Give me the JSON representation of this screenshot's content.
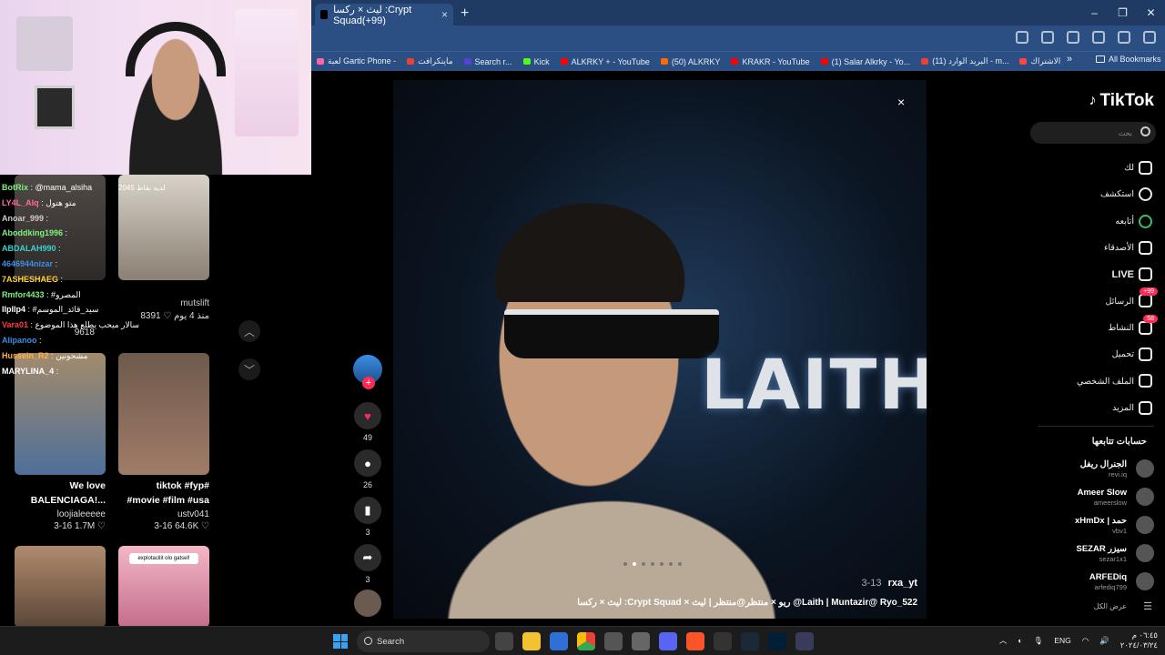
{
  "browser": {
    "tab_title": "ليث × ركسا :Crypt Squad(+99)",
    "tab_close": "×",
    "new_tab": "+",
    "window_buttons": [
      "–",
      "❐",
      "✕"
    ],
    "bookmarks": [
      {
        "label": "الاشتراك",
        "color": "#ff4444"
      },
      {
        "label": "البريد الوارد (11) - m...",
        "color": "#ea4335"
      },
      {
        "label": "(1) Salar Alkrky - Yo...",
        "color": "#ff0000"
      },
      {
        "label": "KRAKR - YouTube",
        "color": "#ff0000"
      },
      {
        "label": "(50) ALKRKY",
        "color": "#ff6a00"
      },
      {
        "label": "ALKRKY + - YouTube",
        "color": "#ff0000"
      },
      {
        "label": "Kick",
        "color": "#53fc18"
      },
      {
        "label": "Search r...",
        "color": "#5b3fd6"
      },
      {
        "label": "ماينكرافت",
        "color": "#ea4335"
      },
      {
        "label": "لعبة Gartic Phone -",
        "color": "#ff66aa"
      }
    ],
    "bookmarks_more": "»",
    "all_bookmarks": "All Bookmarks"
  },
  "chat": [
    {
      "user": "BotRix",
      "text": ": @mama_alsiha",
      "color": "#7cf27c"
    },
    {
      "user": "LY4L_Alq",
      "text": ": متو هتول",
      "color": "#ff6b9d"
    },
    {
      "user": "Anoar_999",
      "text": ":",
      "color": "#ccc"
    },
    {
      "user": "Aboddking1996",
      "text": ":",
      "color": "#7cf27c"
    },
    {
      "user": "ABDALAH990",
      "text": ":",
      "color": "#3ad1d1"
    },
    {
      "user": "4646944nizar",
      "text": ":",
      "color": "#3a8fe6"
    },
    {
      "user": "7ASHESHAEG",
      "text": ":",
      "color": "#ffd23a"
    },
    {
      "user": "Rmfor4433",
      "text": ": #المصرو",
      "color": "#7cf27c"
    },
    {
      "user": "llpllp4",
      "text": ": #سيد_قائد_الموسم",
      "color": "#fff"
    },
    {
      "user": "Vara01",
      "text": ": سالار ميحب يطلع هذا الموضوع",
      "color": "#ff3d3d"
    },
    {
      "user": "Alipanoo",
      "text": ":",
      "color": "#3a8fe6"
    },
    {
      "user": "Hussein_R2",
      "text": ": مشحونين",
      "color": "#ffb347"
    },
    {
      "user": "MARYLINA_4",
      "text": ":",
      "color": "#fff"
    }
  ],
  "left_feed": {
    "t2_overlay": "لديه نقاط 2045",
    "item1": {
      "user": "mutslift",
      "likes": "8391 ♡",
      "date": "منذ 4 يوم",
      "views": "9618"
    },
    "item2": {
      "caption_1": "We love",
      "caption_2": "BALENCIAGA!...",
      "user": "loojialeeeee",
      "date": "3-16",
      "likes": "1.7M ♡"
    },
    "item3": {
      "caption_1": "tiktok #fyp#",
      "caption_2": "#movie #film #usa",
      "user": "ustv041",
      "date": "3-16",
      "likes": "64.6K ♡"
    },
    "item6_banner": "explotacilit olo gatsel!"
  },
  "post": {
    "overlay_title": "LAITH",
    "author": "rxa_yt",
    "date": "3-13",
    "description": "ليث × ركسا :Crypt Squad × ريو × منتظر@منتظر | ليث @Laith | Muntazir@ Ryo_522",
    "likes": "49",
    "comments": "26",
    "saves": "3",
    "shares": "3",
    "close": "×",
    "follow_plus": "+"
  },
  "sidebar": {
    "logo": "TikTok",
    "search_placeholder": "بحث",
    "nav": [
      {
        "label": "لك",
        "icon": "home-icon",
        "bold": false
      },
      {
        "label": "استكشف",
        "icon": "compass-icon",
        "bold": false
      },
      {
        "label": "أتابعه",
        "icon": "following-icon",
        "bold": false
      },
      {
        "label": "الأصدقاء",
        "icon": "friends-icon",
        "bold": false
      },
      {
        "label": "LIVE",
        "icon": "live-icon",
        "bold": true
      },
      {
        "label": "الرسائل",
        "icon": "messages-icon",
        "bold": false,
        "badge": "+99"
      },
      {
        "label": "النشاط",
        "icon": "activity-icon",
        "bold": false,
        "badge": "58"
      },
      {
        "label": "تحميل",
        "icon": "upload-icon",
        "bold": false
      },
      {
        "label": "الملف الشخصي",
        "icon": "profile-icon",
        "bold": false
      },
      {
        "label": "المزيد",
        "icon": "more-icon",
        "bold": false
      }
    ],
    "following_header": "حسابات تتابعها",
    "following": [
      {
        "name": "الجنرال ريفل",
        "user": "revi.iq"
      },
      {
        "name": "Ameer Slow",
        "user": "ameerslow"
      },
      {
        "name": "xHmDx | حمد",
        "user": "vbv1"
      },
      {
        "name": "SEZAR سيزر",
        "user": "sezar1x1"
      },
      {
        "name": "ARFEDiq",
        "user": "arfediq799"
      }
    ],
    "see_all": "عرض الكل"
  },
  "taskbar": {
    "search_label": "Search",
    "lang": "ENG",
    "time": "٠٦:٤٥ م",
    "date": "٢٠٢٤/٠٣/٢٤"
  }
}
